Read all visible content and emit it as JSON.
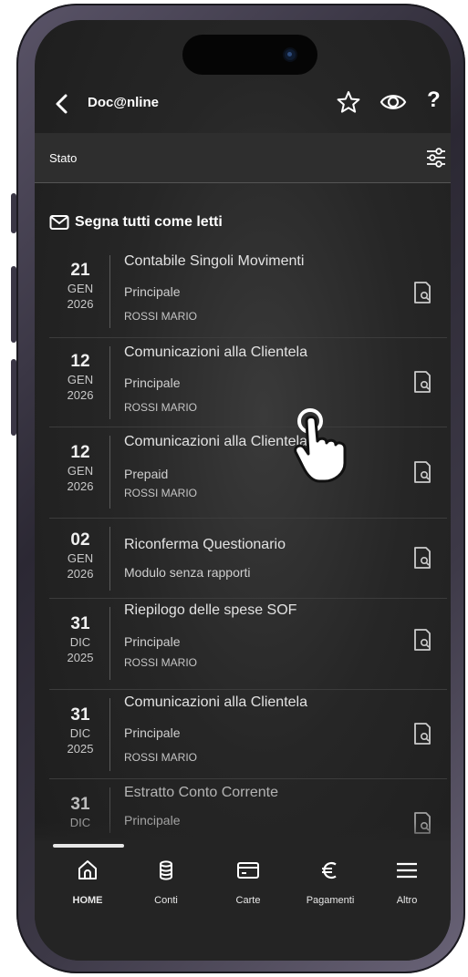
{
  "header": {
    "back_icon": "chevron-left-icon",
    "title": "Doc@nline",
    "star_icon": "star-icon",
    "eye_icon": "eye-icon",
    "help_label": "?"
  },
  "filter": {
    "label": "Stato",
    "icon": "sliders-icon"
  },
  "mark_all": {
    "label": "Segna tutti come letti",
    "icon": "mail-icon"
  },
  "documents": [
    {
      "day": "21",
      "month": "GEN",
      "year": "2026",
      "title": "Contabile Singoli Movimenti",
      "account": "Principale",
      "holder": "ROSSI MARIO"
    },
    {
      "day": "12",
      "month": "GEN",
      "year": "2026",
      "title": "Comunicazioni alla Clientela",
      "account": "Principale",
      "holder": "ROSSI MARIO"
    },
    {
      "day": "12",
      "month": "GEN",
      "year": "2026",
      "title": "Comunicazioni alla Clientela",
      "account": "Prepaid",
      "holder": "ROSSI MARIO"
    },
    {
      "day": "02",
      "month": "GEN",
      "year": "2026",
      "title": "Riconferma Questionario",
      "account": "Modulo senza rapporti",
      "holder": ""
    },
    {
      "day": "31",
      "month": "DIC",
      "year": "2025",
      "title": "Riepilogo delle spese SOF",
      "account": "Principale",
      "holder": "ROSSI MARIO"
    },
    {
      "day": "31",
      "month": "DIC",
      "year": "2025",
      "title": "Comunicazioni alla Clientela",
      "account": "Principale",
      "holder": "ROSSI MARIO"
    },
    {
      "day": "31",
      "month": "DIC",
      "year": "",
      "title": "Estratto Conto Corrente",
      "account": "Principale",
      "holder": ""
    }
  ],
  "nav": {
    "items": [
      {
        "label": "HOME",
        "icon": "home-icon"
      },
      {
        "label": "Conti",
        "icon": "coins-icon"
      },
      {
        "label": "Carte",
        "icon": "card-icon"
      },
      {
        "label": "Pagamenti",
        "icon": "euro-icon"
      },
      {
        "label": "Altro",
        "icon": "menu-icon"
      }
    ]
  },
  "colors": {
    "background": "#262626",
    "text": "#ffffff",
    "muted": "#cfcfcf"
  }
}
